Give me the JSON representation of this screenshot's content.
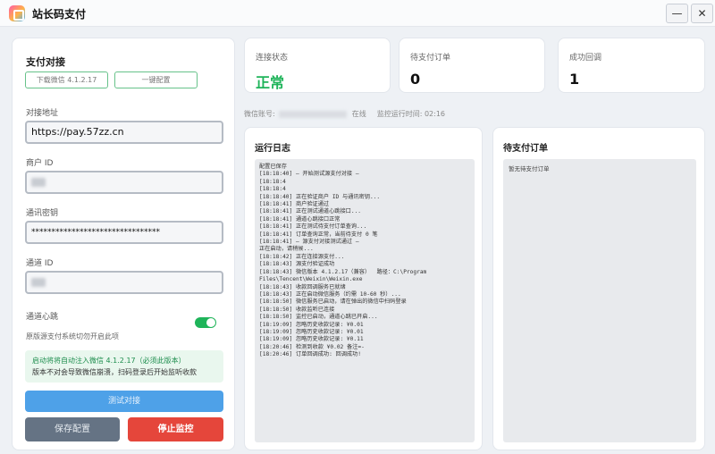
{
  "app": {
    "title": "站长码支付",
    "minimize": "—",
    "close": "✕",
    "logo_icon": "app-logo"
  },
  "left": {
    "title": "支付对接",
    "download_button": "下载微信 4.1.2.17",
    "oneclick_button": "一键配置",
    "address_label": "对接地址",
    "address_value": "https://pay.57zz.cn",
    "merchant_label": "商户 ID",
    "secret_label": "通讯密钥",
    "secret_value": "********************************",
    "channel_label": "通道 ID",
    "heartbeat_label": "通道心跳",
    "heartbeat_on": true,
    "heartbeat_hint": "原版源支付系统切勿开启此项",
    "notice_line1": "启动将将自动注入微信 4.1.2.17（必须此版本）",
    "notice_line2": "版本不对会导致微信崩溃，扫码登录后开始监听收款",
    "test_button": "测试对接",
    "save_button": "保存配置",
    "stop_button": "停止监控"
  },
  "stats": [
    {
      "label": "连接状态",
      "value": "正常"
    },
    {
      "label": "待支付订单",
      "value": "0"
    },
    {
      "label": "成功回调",
      "value": "1"
    }
  ],
  "status": {
    "wechat_label": "微信账号:",
    "online": "在线",
    "uptime_label": "监控运行时间: 02:16"
  },
  "log": {
    "title": "运行日志",
    "lines": [
      "配置已保存",
      "[18:18:40] — 开始测试源支付对接 —",
      "[18:18:4",
      "[18:18:4",
      "[18:18:40] 正在验证商户 ID 与通讯密钥...",
      "[18:18:41] 商户验证通过",
      "[18:18:41] 正在测试通道心跳接口...",
      "[18:18:41] 通道心跳接口正常",
      "[18:18:41] 正在测试待支付订单查询...",
      "[18:18:41] 订单查询正常，当前待支付 0 笔",
      "[18:18:41] — 源支付对接测试通过 —",
      "正在启动，请稍候...",
      "[18:18:42] 正在连接源支付...",
      "[18:18:43] 源支付验证成功",
      "[18:18:43] 微信版本 4.1.2.17（兼容）  路径：C:\\Program",
      "Files\\Tencent\\Weixin\\Weixin.exe",
      "[18:18:43] 收款回调服务已就绪",
      "[18:18:43] 正在启动微信服务（约需 10-60 秒）...",
      "[18:18:50] 微信服务已启动，请在弹出的微信中扫码登录",
      "[18:18:50] 收款监听已连接",
      "[18:18:50] 监控已启动，通道心跳已开启...",
      "[18:19:09] 忽略历史收款记录: ¥0.01",
      "[18:19:09] 忽略历史收款记录: ¥0.01",
      "[18:19:09] 忽略历史收款记录: ¥0.11",
      "[18:20:46] 检测到收款 ¥0.02 备注=-",
      "[18:20:46] 订单回调成功: 回调成功!"
    ]
  },
  "pending": {
    "title": "待支付订单",
    "empty": "暂无待支付订单"
  }
}
